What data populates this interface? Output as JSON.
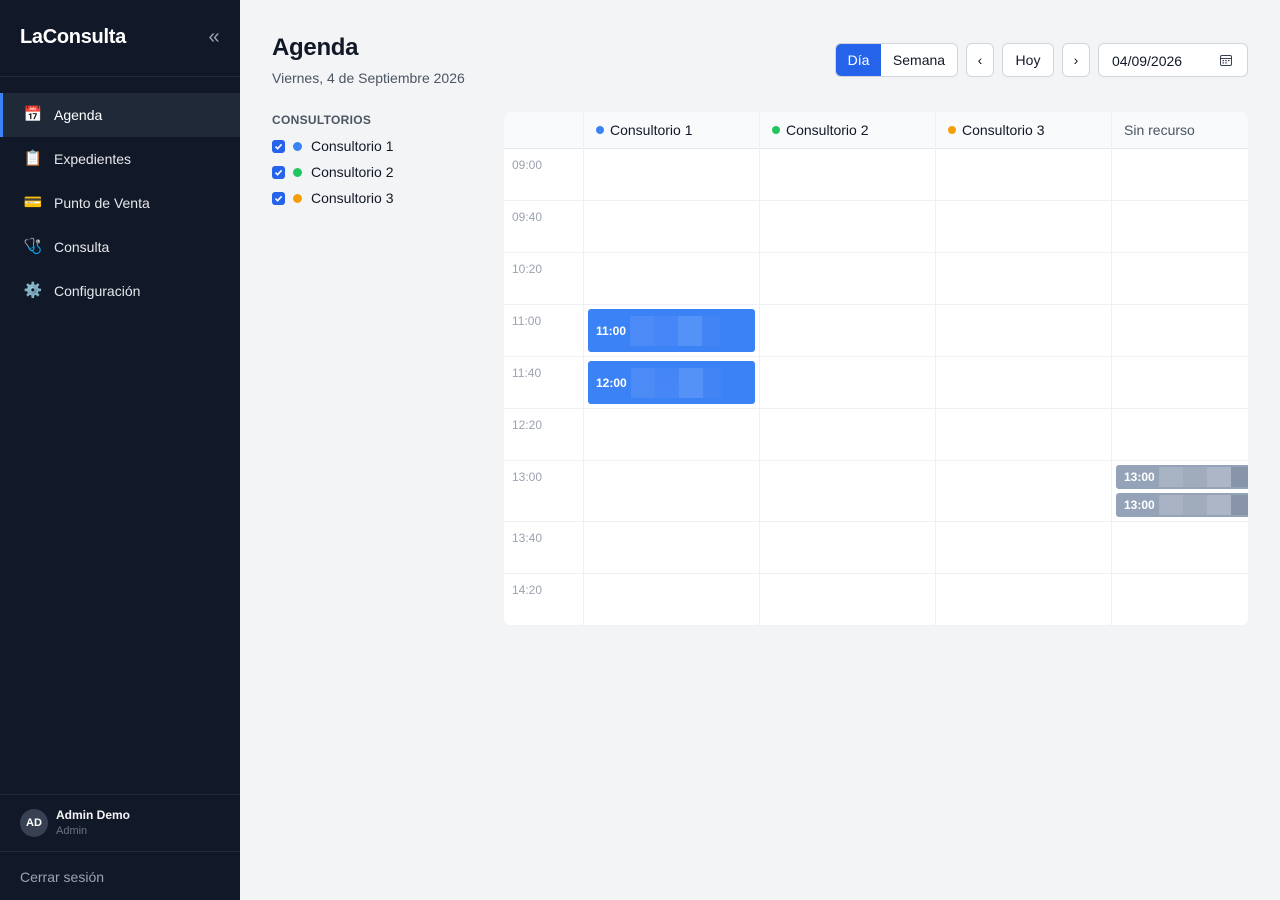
{
  "app": {
    "brand": "LaConsulta",
    "collapse_icon": "«"
  },
  "sidebar": {
    "items": [
      {
        "label": "Agenda",
        "icon": "📅",
        "active": true
      },
      {
        "label": "Expedientes",
        "icon": "📋"
      },
      {
        "label": "Punto de Venta",
        "icon": "💳"
      },
      {
        "label": "Consulta",
        "icon": "🩺"
      },
      {
        "label": "Configuración",
        "icon": "⚙️"
      }
    ],
    "user": {
      "initials": "AD",
      "name": "Admin Demo",
      "role": "Admin"
    },
    "logout": "Cerrar sesión"
  },
  "header": {
    "title": "Agenda",
    "date_text": "Viernes, 4 de Septiembre 2026",
    "view_day": "Día",
    "view_week": "Semana",
    "prev": "‹",
    "today": "Hoy",
    "next": "›",
    "date_value": "04/09/2026"
  },
  "filters": {
    "title": "CONSULTORIOS",
    "items": [
      {
        "label": "Consultorio 1",
        "color": "#3b82f6",
        "checked": true
      },
      {
        "label": "Consultorio 2",
        "color": "#22c55e",
        "checked": true
      },
      {
        "label": "Consultorio 3",
        "color": "#f59e0b",
        "checked": true
      }
    ]
  },
  "calendar": {
    "columns": [
      {
        "label": "Consultorio 1",
        "color": "#3b82f6"
      },
      {
        "label": "Consultorio 2",
        "color": "#22c55e"
      },
      {
        "label": "Consultorio 3",
        "color": "#f59e0b"
      },
      {
        "label": "Sin recurso",
        "color": ""
      }
    ],
    "times": [
      "09:00",
      "09:40",
      "10:20",
      "11:00",
      "11:40",
      "12:20",
      "13:00",
      "13:40",
      "14:20"
    ],
    "events": [
      {
        "time": "11:00",
        "column": 0,
        "color": "#3b82f6"
      },
      {
        "time": "12:00",
        "column": 0,
        "color": "#3b82f6"
      },
      {
        "time": "13:00",
        "column": 3,
        "color": "#94a3b8"
      },
      {
        "time": "13:00",
        "column": 3,
        "color": "#94a3b8"
      }
    ]
  }
}
